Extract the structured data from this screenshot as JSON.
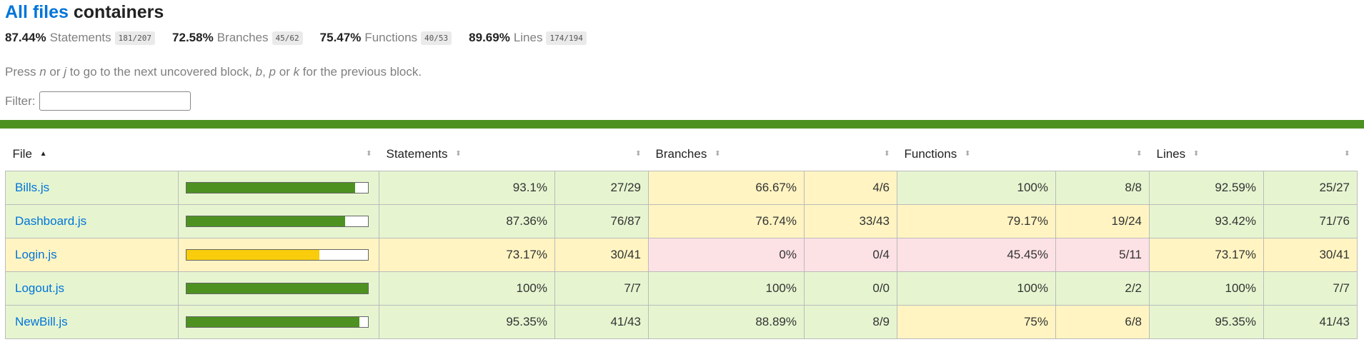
{
  "header": {
    "title_link": "All files",
    "title_rest": "containers"
  },
  "summary": [
    {
      "pct": "87.44%",
      "label": "Statements",
      "fraction": "181/207"
    },
    {
      "pct": "72.58%",
      "label": "Branches",
      "fraction": "45/62"
    },
    {
      "pct": "75.47%",
      "label": "Functions",
      "fraction": "40/53"
    },
    {
      "pct": "89.69%",
      "label": "Lines",
      "fraction": "174/194"
    }
  ],
  "hint": {
    "p1": "Press ",
    "k1": "n",
    "p2": " or ",
    "k2": "j",
    "p3": " to go to the next uncovered block, ",
    "k3": "b",
    "p4": ", ",
    "k4": "p",
    "p5": " or ",
    "k5": "k",
    "p6": " for the previous block."
  },
  "filter": {
    "label": "Filter:",
    "value": ""
  },
  "colors": {
    "high": "#e6f5d0",
    "medium": "#fff4c2",
    "low": "#fce1e5",
    "bar_high": "#4d9221",
    "bar_medium": "#f9cd0b",
    "link": "#0074D9"
  },
  "table": {
    "headers": {
      "file": "File",
      "statements": "Statements",
      "branches": "Branches",
      "functions": "Functions",
      "lines": "Lines"
    },
    "sort_icons": {
      "active": "▲",
      "inactive": "⬍"
    },
    "rows": [
      {
        "file": "Bills.js",
        "coverage": 0.931,
        "level": "high",
        "statements": {
          "pct": "93.1%",
          "abs": "27/29",
          "level": "high"
        },
        "branches": {
          "pct": "66.67%",
          "abs": "4/6",
          "level": "medium"
        },
        "functions": {
          "pct": "100%",
          "abs": "8/8",
          "level": "high"
        },
        "lines": {
          "pct": "92.59%",
          "abs": "25/27",
          "level": "high"
        }
      },
      {
        "file": "Dashboard.js",
        "coverage": 0.8736,
        "level": "high",
        "statements": {
          "pct": "87.36%",
          "abs": "76/87",
          "level": "high"
        },
        "branches": {
          "pct": "76.74%",
          "abs": "33/43",
          "level": "medium"
        },
        "functions": {
          "pct": "79.17%",
          "abs": "19/24",
          "level": "medium"
        },
        "lines": {
          "pct": "93.42%",
          "abs": "71/76",
          "level": "high"
        }
      },
      {
        "file": "Login.js",
        "coverage": 0.7317,
        "level": "medium",
        "statements": {
          "pct": "73.17%",
          "abs": "30/41",
          "level": "medium"
        },
        "branches": {
          "pct": "0%",
          "abs": "0/4",
          "level": "low"
        },
        "functions": {
          "pct": "45.45%",
          "abs": "5/11",
          "level": "low"
        },
        "lines": {
          "pct": "73.17%",
          "abs": "30/41",
          "level": "medium"
        }
      },
      {
        "file": "Logout.js",
        "coverage": 1.0,
        "level": "high",
        "statements": {
          "pct": "100%",
          "abs": "7/7",
          "level": "high"
        },
        "branches": {
          "pct": "100%",
          "abs": "0/0",
          "level": "high"
        },
        "functions": {
          "pct": "100%",
          "abs": "2/2",
          "level": "high"
        },
        "lines": {
          "pct": "100%",
          "abs": "7/7",
          "level": "high"
        }
      },
      {
        "file": "NewBill.js",
        "coverage": 0.9535,
        "level": "high",
        "statements": {
          "pct": "95.35%",
          "abs": "41/43",
          "level": "high"
        },
        "branches": {
          "pct": "88.89%",
          "abs": "8/9",
          "level": "high"
        },
        "functions": {
          "pct": "75%",
          "abs": "6/8",
          "level": "medium"
        },
        "lines": {
          "pct": "95.35%",
          "abs": "41/43",
          "level": "high"
        }
      }
    ]
  }
}
